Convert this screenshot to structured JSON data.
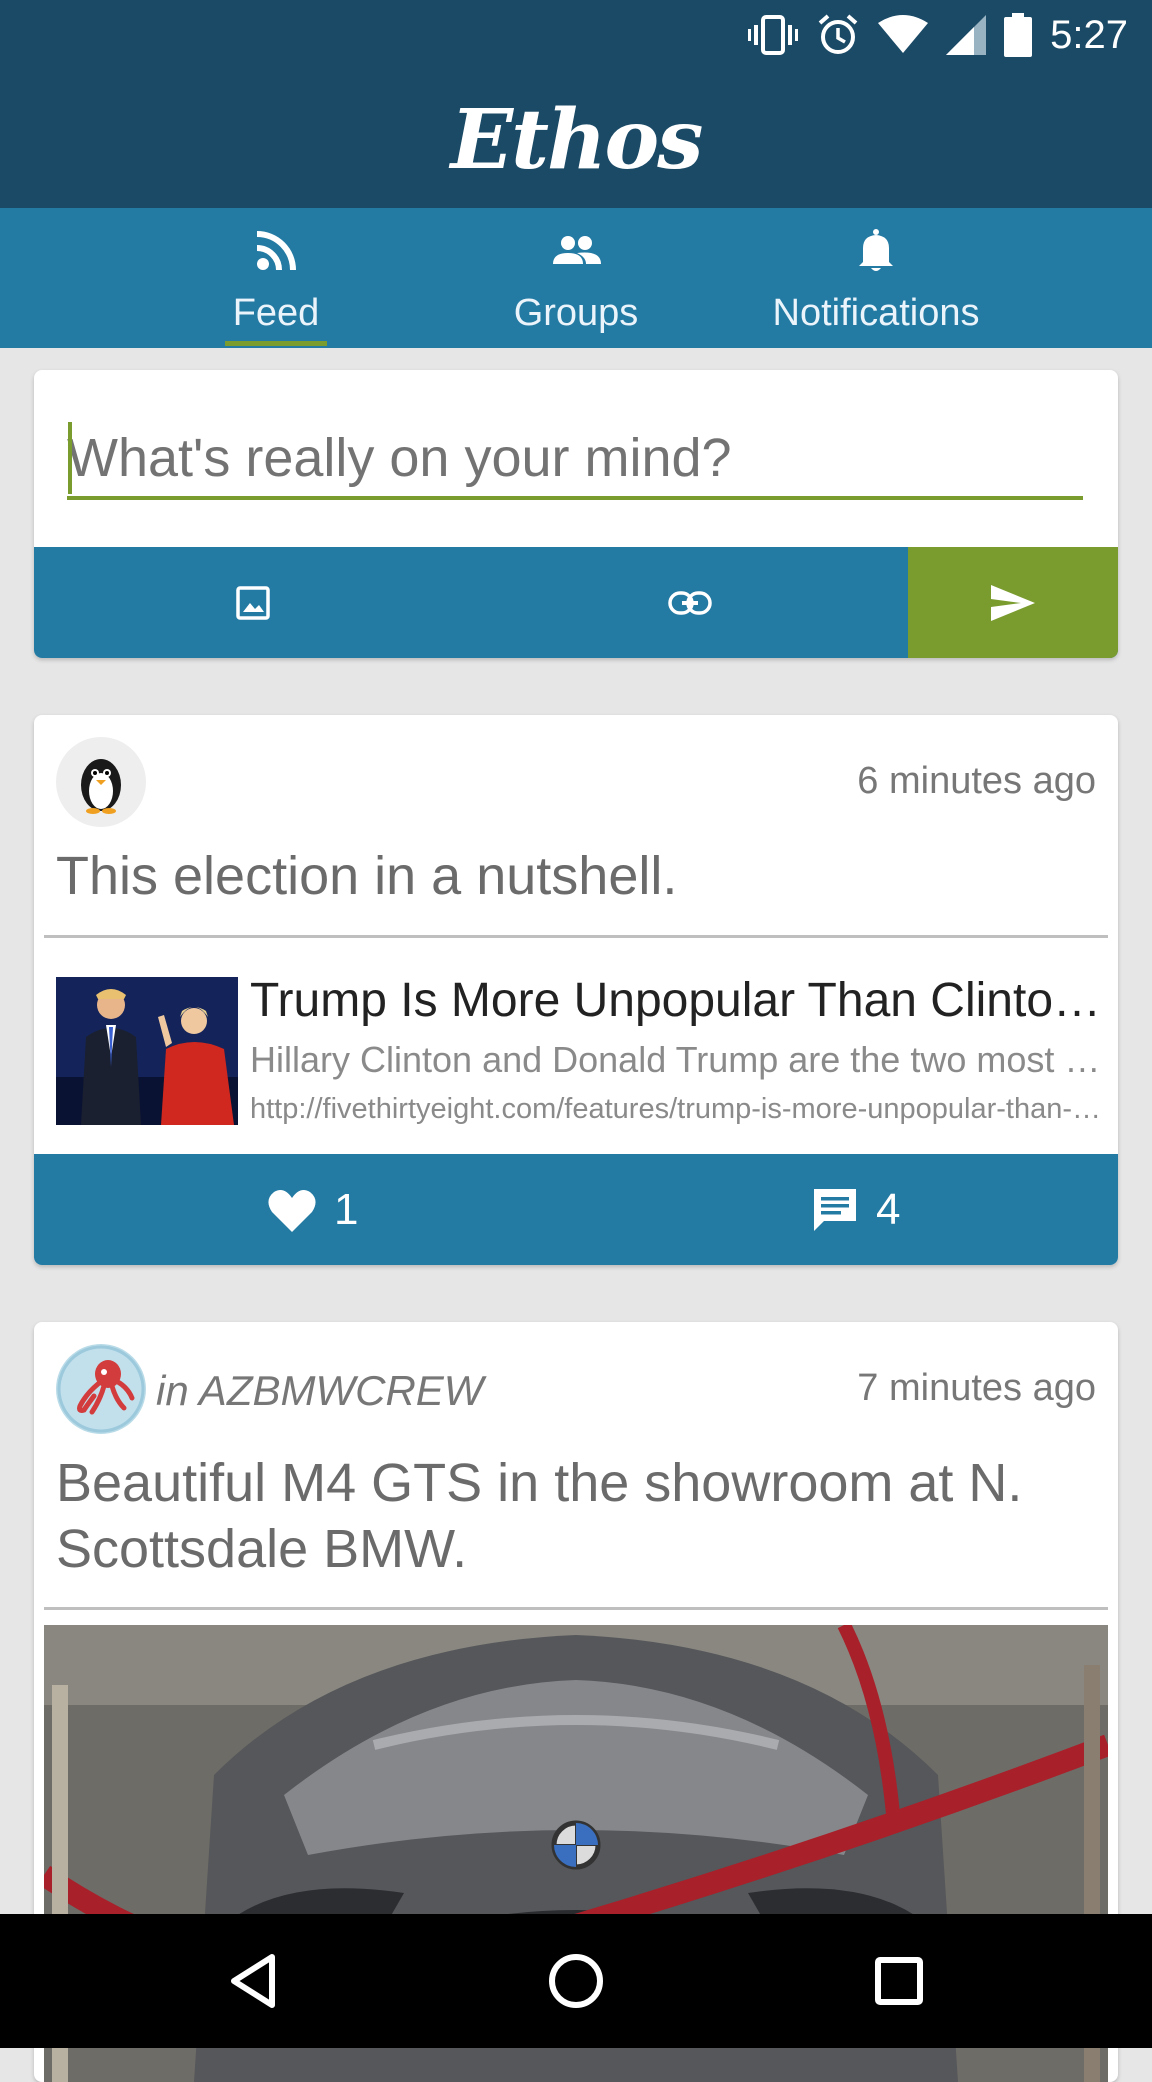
{
  "status_bar": {
    "time": "5:27",
    "icons": [
      "vibrate-icon",
      "alarm-icon",
      "wifi-icon",
      "signal-icon",
      "battery-icon"
    ]
  },
  "app": {
    "title": "Ethos"
  },
  "tabs": [
    {
      "label": "Feed",
      "icon": "rss-icon",
      "selected": true
    },
    {
      "label": "Groups",
      "icon": "groups-icon",
      "selected": false
    },
    {
      "label": "Notifications",
      "icon": "bell-icon",
      "selected": false
    }
  ],
  "composer": {
    "placeholder": "What's really on your mind?",
    "value": ""
  },
  "posts": [
    {
      "time": "6 minutes ago",
      "text": "This election in a nutshell.",
      "link": {
        "title": "Trump Is More Unpopular Than Clinton Is",
        "description": "Hillary Clinton and Donald Trump are the two most unpopular",
        "url": "http://fivethirtyeight.com/features/trump-is-more-unpopular-than-clinton-is/"
      },
      "likes": "1",
      "comments": "4"
    },
    {
      "group": "in AZBMWCREW",
      "time": "7 minutes ago",
      "text": "Beautiful M4 GTS in the showroom at N. Scottsdale BMW."
    }
  ],
  "colors": {
    "header": "#1a4a66",
    "tabbar": "#237aa3",
    "accent": "#7a9c2f"
  }
}
